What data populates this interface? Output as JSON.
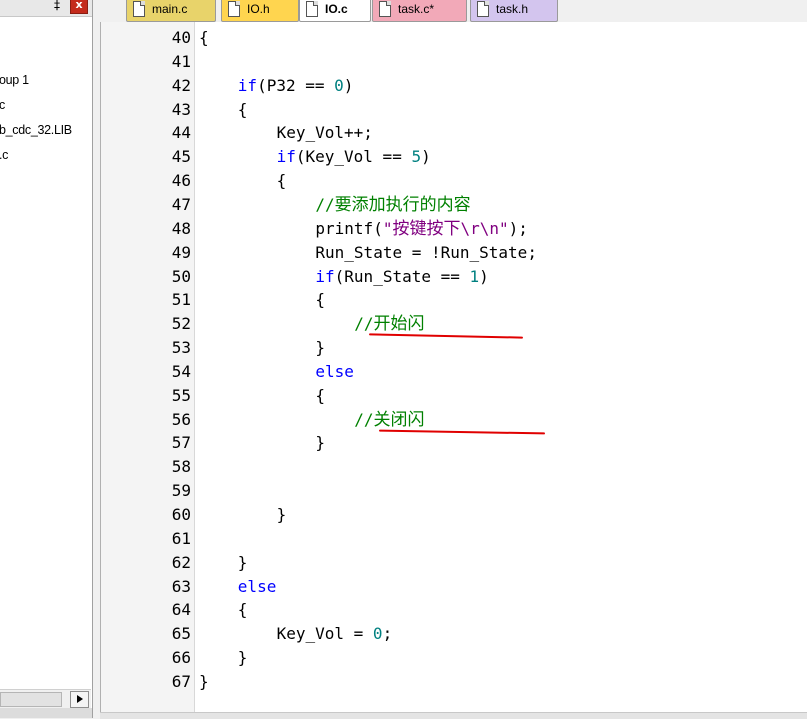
{
  "project_panel": {
    "pin_glyph": "‡",
    "close_glyph": "x",
    "items": [
      {
        "label": "oup 1"
      },
      {
        "label": "c"
      },
      {
        "label": "b_cdc_32.LIB"
      },
      {
        "label": ".c"
      }
    ]
  },
  "tabs": [
    {
      "label": "main.c",
      "color": "#e8d36a",
      "active": false
    },
    {
      "label": "IO.h",
      "color": "#ffd54f",
      "active": false
    },
    {
      "label": "IO.c",
      "color": "#ffffff",
      "active": true
    },
    {
      "label": "task.c*",
      "color": "#f2a9b8",
      "active": false
    },
    {
      "label": "task.h",
      "color": "#d3c5ee",
      "active": false
    }
  ],
  "code_lines": [
    {
      "n": "40",
      "i": 0,
      "t": [
        [
          "",
          "{"
        ]
      ]
    },
    {
      "n": "41",
      "i": 0,
      "t": []
    },
    {
      "n": "42",
      "i": 4,
      "t": [
        [
          "kw",
          "if"
        ],
        [
          "",
          "(P32 == "
        ],
        [
          "num",
          "0"
        ],
        [
          "",
          ")"
        ]
      ]
    },
    {
      "n": "43",
      "i": 4,
      "t": [
        [
          "",
          "{"
        ]
      ]
    },
    {
      "n": "44",
      "i": 8,
      "t": [
        [
          "",
          "Key_Vol++;"
        ]
      ]
    },
    {
      "n": "45",
      "i": 8,
      "t": [
        [
          "kw",
          "if"
        ],
        [
          "",
          "(Key_Vol == "
        ],
        [
          "num",
          "5"
        ],
        [
          "",
          ")"
        ]
      ]
    },
    {
      "n": "46",
      "i": 8,
      "t": [
        [
          "",
          "{"
        ]
      ]
    },
    {
      "n": "47",
      "i": 12,
      "t": [
        [
          "cmt",
          "//"
        ],
        [
          "cmt cn",
          "要添加执行的内容"
        ]
      ]
    },
    {
      "n": "48",
      "i": 12,
      "t": [
        [
          "",
          "printf("
        ],
        [
          "str",
          "\""
        ],
        [
          "str cn",
          "按键按下"
        ],
        [
          "str",
          "\\r\\n\""
        ],
        [
          "",
          ");"
        ]
      ]
    },
    {
      "n": "49",
      "i": 12,
      "t": [
        [
          "",
          "Run_State = !Run_State;"
        ]
      ]
    },
    {
      "n": "50",
      "i": 12,
      "t": [
        [
          "kw",
          "if"
        ],
        [
          "",
          "(Run_State == "
        ],
        [
          "num",
          "1"
        ],
        [
          "",
          ")"
        ]
      ]
    },
    {
      "n": "51",
      "i": 12,
      "t": [
        [
          "",
          "{"
        ]
      ]
    },
    {
      "n": "52",
      "i": 16,
      "t": [
        [
          "cmt",
          "//"
        ],
        [
          "cmt cn",
          "开始闪"
        ]
      ]
    },
    {
      "n": "53",
      "i": 12,
      "t": [
        [
          "",
          "}"
        ]
      ]
    },
    {
      "n": "54",
      "i": 12,
      "t": [
        [
          "kw",
          "else"
        ]
      ]
    },
    {
      "n": "55",
      "i": 12,
      "t": [
        [
          "",
          "{"
        ]
      ]
    },
    {
      "n": "56",
      "i": 16,
      "t": [
        [
          "cmt",
          "//"
        ],
        [
          "cmt cn",
          "关闭闪"
        ]
      ]
    },
    {
      "n": "57",
      "i": 12,
      "t": [
        [
          "",
          "}"
        ]
      ]
    },
    {
      "n": "58",
      "i": 0,
      "t": []
    },
    {
      "n": "59",
      "i": 0,
      "t": []
    },
    {
      "n": "60",
      "i": 8,
      "t": [
        [
          "",
          "}"
        ]
      ]
    },
    {
      "n": "61",
      "i": 0,
      "t": []
    },
    {
      "n": "62",
      "i": 4,
      "t": [
        [
          "",
          "}"
        ]
      ]
    },
    {
      "n": "63",
      "i": 4,
      "t": [
        [
          "kw",
          "else"
        ]
      ]
    },
    {
      "n": "64",
      "i": 4,
      "t": [
        [
          "",
          "{"
        ]
      ]
    },
    {
      "n": "65",
      "i": 8,
      "t": [
        [
          "",
          "Key_Vol = "
        ],
        [
          "num",
          "0"
        ],
        [
          "",
          ";"
        ]
      ]
    },
    {
      "n": "66",
      "i": 4,
      "t": [
        [
          "",
          "}"
        ]
      ]
    },
    {
      "n": "67",
      "i": 0,
      "t": [
        [
          "",
          "}"
        ]
      ]
    }
  ],
  "colors": {
    "keyword": "#0000ff",
    "number": "#008080",
    "string": "#800080",
    "comment": "#008000",
    "annotation": "#e00000"
  }
}
